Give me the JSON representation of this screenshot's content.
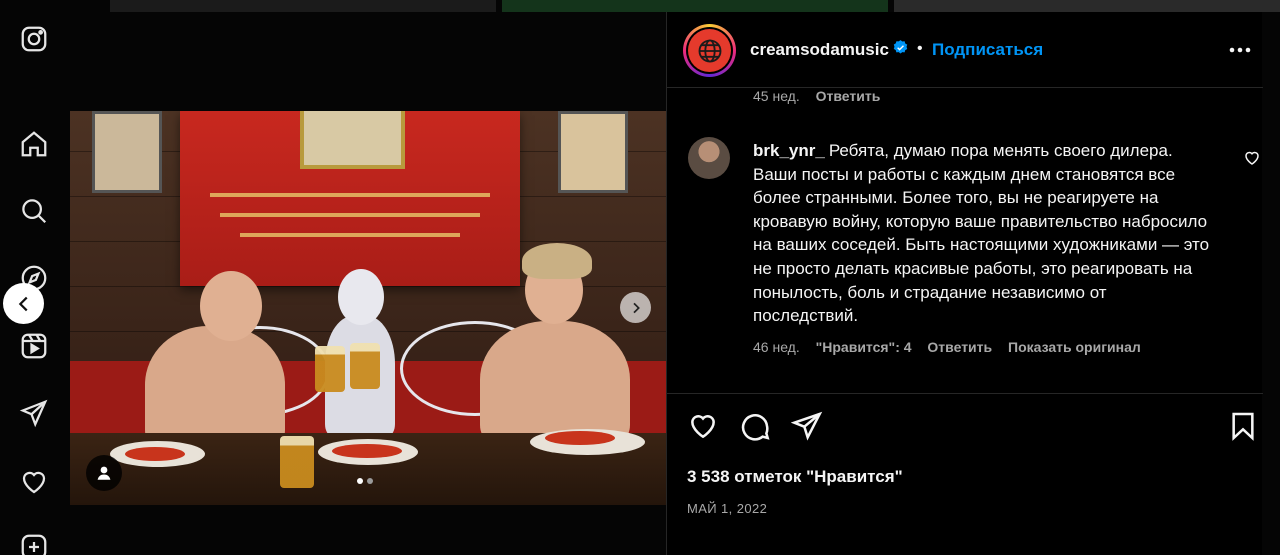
{
  "sidebar": {
    "icons": [
      "instagram-icon",
      "home-icon",
      "search-icon",
      "explore-icon",
      "reels-icon",
      "direct-icon",
      "notifications-icon",
      "create-icon"
    ]
  },
  "post": {
    "username": "creamsodamusic",
    "verified": true,
    "separator": "•",
    "follow_label": "Подписаться",
    "more_icon": "more-options-icon",
    "carousel": {
      "total": 2,
      "current": 1
    },
    "likes_text": "3 538 отметок \"Нравится\"",
    "date": "МАЙ 1, 2022"
  },
  "comments": {
    "prev_meta": {
      "age": "45 нед.",
      "reply": "Ответить"
    },
    "items": [
      {
        "username": "brk_ynr_",
        "text": "Ребята, думаю пора менять своего дилера. Ваши посты и работы с каждым днем становятся все более странными. Более того, вы не реагируете на кровавую войну, которую ваше правительство набросило на ваших соседей. Быть настоящими художниками — это не просто делать красивые работы, это реагировать на понылость, боль и страдание независимо от последствий.",
        "age": "46 нед.",
        "likes": "\"Нравится\": 4",
        "reply": "Ответить",
        "show_original": "Показать оригинал"
      }
    ]
  },
  "colors": {
    "accent": "#0095f6",
    "muted": "#a8a8a8",
    "text": "#f5f5f5",
    "border": "#262626"
  }
}
